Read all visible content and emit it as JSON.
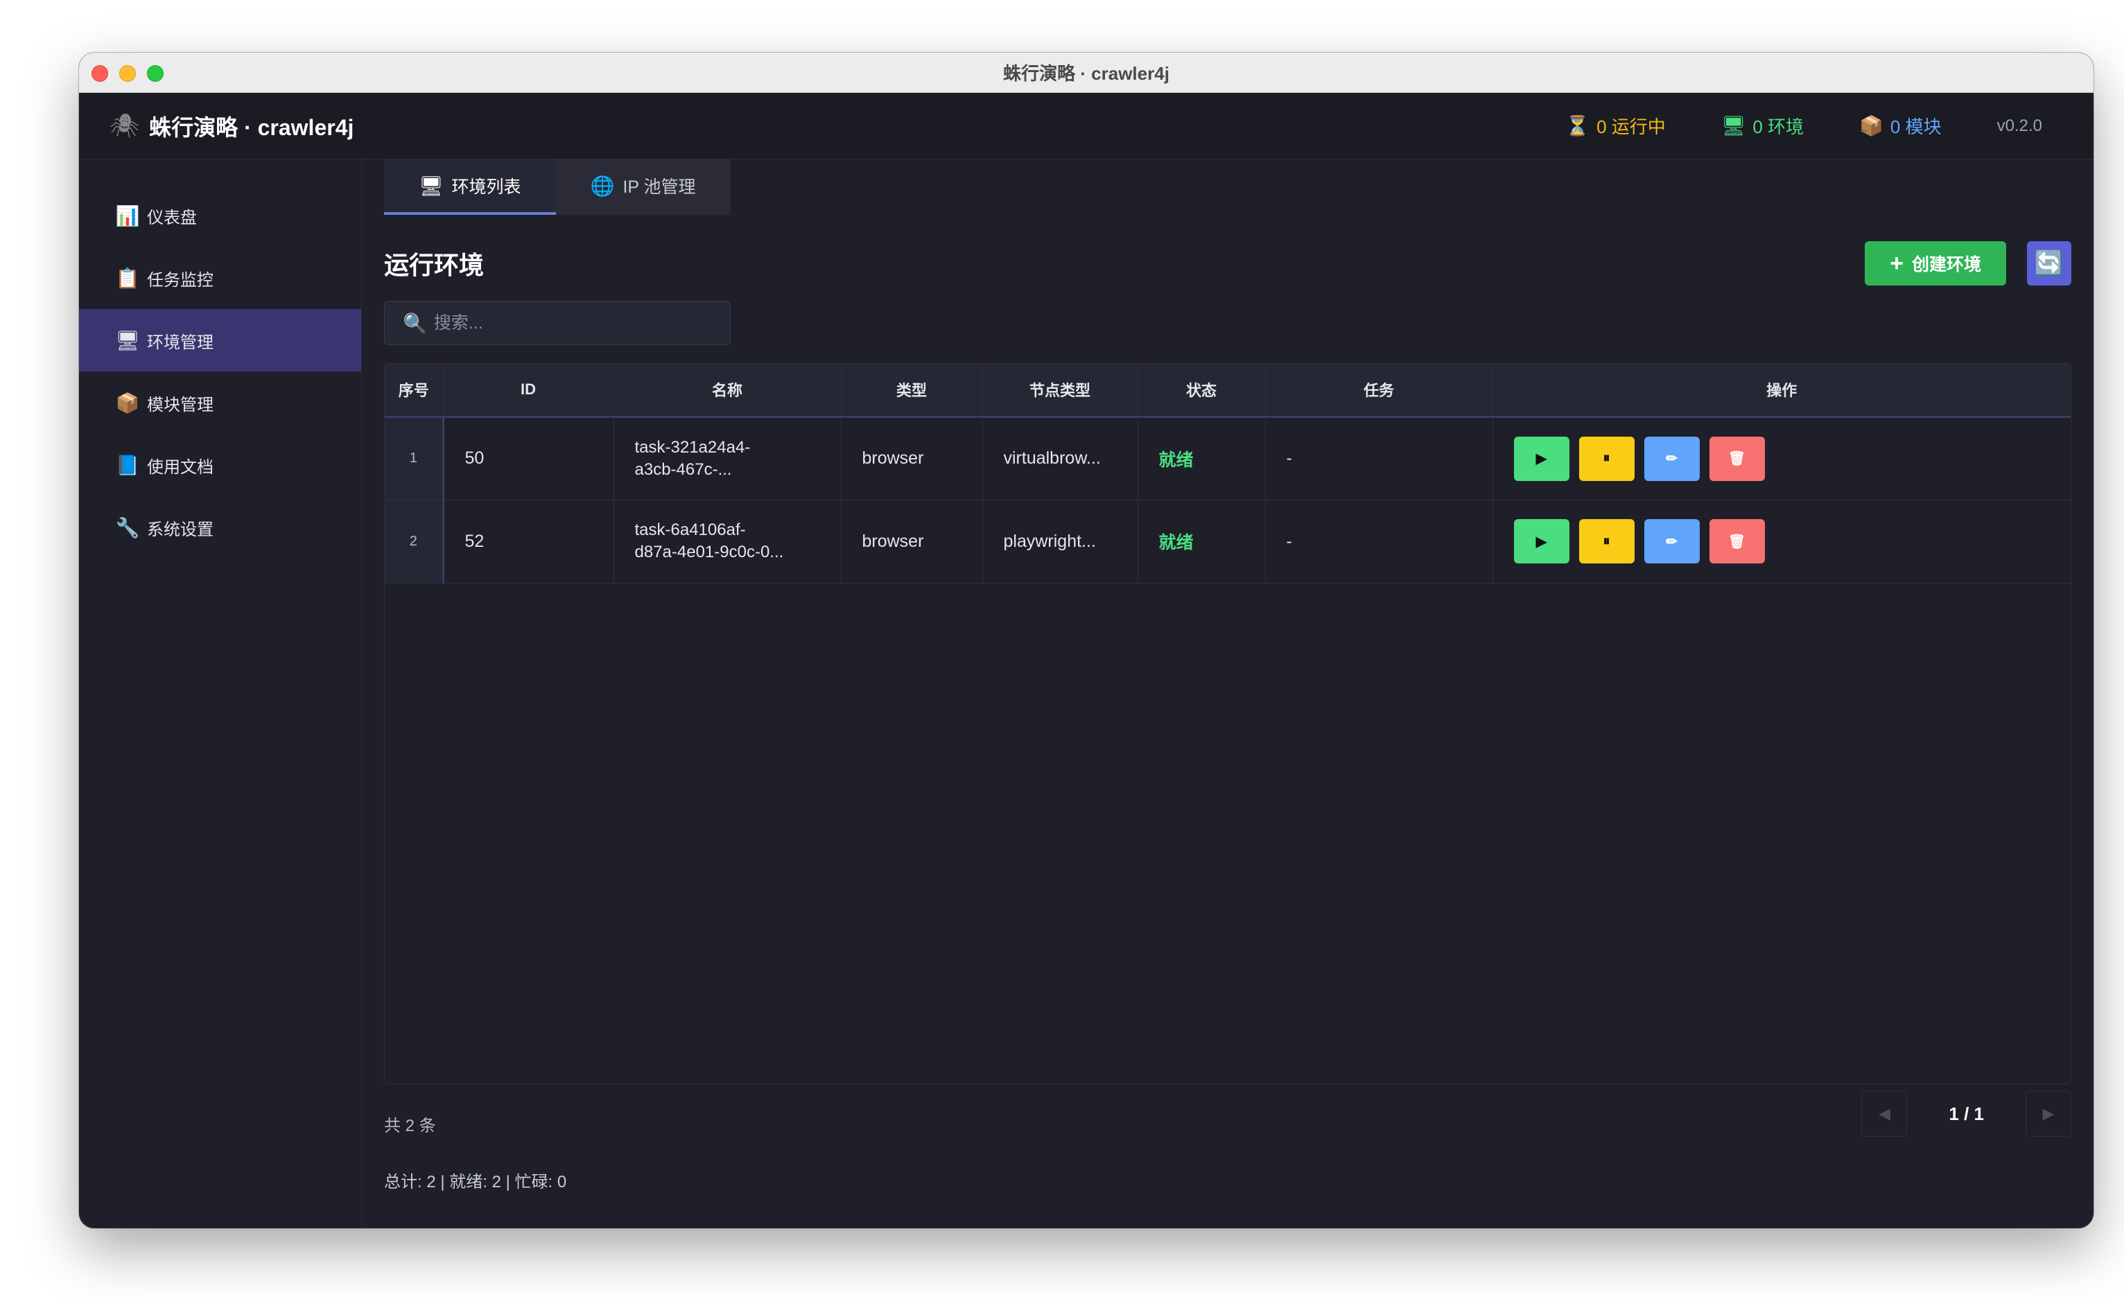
{
  "window": {
    "title": "蛛行演略 · crawler4j"
  },
  "appbar": {
    "logo_icon": "spider-icon",
    "name": "蛛行演略 · crawler4j",
    "running": "0 运行中",
    "environments": "0 环境",
    "modules": "0 模块",
    "version": "v0.2.0"
  },
  "sidebar": {
    "items": [
      {
        "label": "仪表盘",
        "icon": "chart-icon"
      },
      {
        "label": "任务监控",
        "icon": "clipboard-icon"
      },
      {
        "label": "环境管理",
        "icon": "monitor-icon",
        "active": true
      },
      {
        "label": "模块管理",
        "icon": "package-icon"
      },
      {
        "label": "使用文档",
        "icon": "book-icon"
      },
      {
        "label": "系统设置",
        "icon": "wrench-icon"
      }
    ]
  },
  "tabs": [
    {
      "label": "环境列表",
      "icon": "monitor-icon",
      "active": true
    },
    {
      "label": "IP 池管理",
      "icon": "globe-icon"
    }
  ],
  "section": {
    "title": "运行环境",
    "create_label": "创建环境",
    "search_placeholder": "搜索..."
  },
  "table": {
    "headers": [
      "序号",
      "ID",
      "名称",
      "类型",
      "节点类型",
      "状态",
      "任务",
      "操作"
    ],
    "rows": [
      {
        "idx": "1",
        "id": "50",
        "name_line1": "task-321a24a4-",
        "name_line2": "a3cb-467c-...",
        "type": "browser",
        "node_type": "virtualbrow...",
        "status": "就绪",
        "task": "-"
      },
      {
        "idx": "2",
        "id": "52",
        "name_line1": "task-6a4106af-",
        "name_line2": "d87a-4e01-9c0c-0...",
        "type": "browser",
        "node_type": "playwright...",
        "status": "就绪",
        "task": "-"
      }
    ]
  },
  "footer": {
    "total": "共 2 条",
    "page": "1 / 1",
    "stats": "总计: 2 | 就绪: 2 | 忙碌: 0"
  },
  "colors": {
    "accent": "#5b5fd8",
    "success": "#2fb554",
    "status_ready": "#4ade80"
  }
}
